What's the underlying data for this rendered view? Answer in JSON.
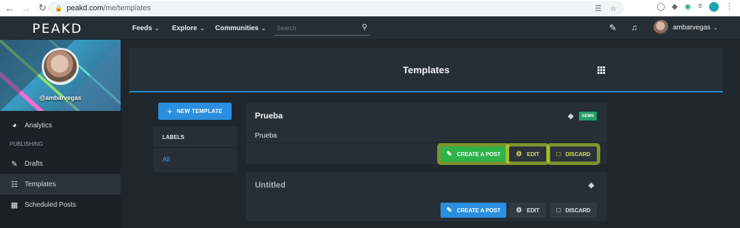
{
  "browser": {
    "url_host": "peakd.com",
    "url_path": "/me/templates"
  },
  "header": {
    "logo": "PEAKD",
    "menu": [
      "Feeds",
      "Explore",
      "Communities"
    ],
    "search_placeholder": "Search",
    "username": "ambarvegas"
  },
  "sidebar": {
    "banner_name": "@ambarvegas",
    "items": [
      {
        "label": "Analytics",
        "icon": "pie-chart-icon"
      },
      {
        "label": "Drafts",
        "icon": "edit-icon"
      },
      {
        "label": "Templates",
        "icon": "file-icon"
      },
      {
        "label": "Scheduled Posts",
        "icon": "calendar-icon"
      }
    ],
    "section_publishing": "PUBLISHING"
  },
  "main": {
    "title": "Templates",
    "new_template": "NEW TEMPLATE",
    "labels_heading": "LABELS",
    "labels_all": "All",
    "cards": [
      {
        "title": "Prueba",
        "body": "Prueba",
        "tag": "GEMS",
        "actions": [
          "CREATE A POST",
          "EDIT",
          "DISCARD"
        ]
      },
      {
        "title": "Untitled",
        "body": "",
        "actions": [
          "CREATE A POST",
          "EDIT",
          "DISCARD"
        ]
      }
    ]
  },
  "colors": {
    "accent_blue": "#2a8fe0",
    "create_green": "#2db34a",
    "gems_tag": "#24a06a",
    "highlight": "#c8e628"
  }
}
